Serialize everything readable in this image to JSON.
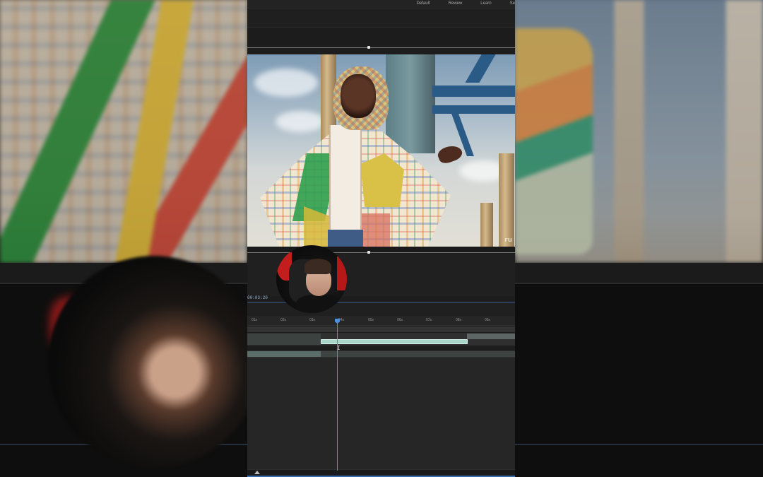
{
  "workspace_tabs": [
    "Default",
    "Review",
    "Learn",
    "Se"
  ],
  "timeline": {
    "timecode": "00:03:20",
    "ruler_ticks": [
      "01s",
      "02s",
      "03s",
      "04s",
      "05s",
      "06s",
      "07s",
      "08s",
      "09s"
    ],
    "playhead_label": "04s"
  },
  "video": {
    "watermark": "ru"
  },
  "colors": {
    "playhead": "#4a90e2",
    "selected_clip": "#a7d6c8",
    "panel_bg": "#1d1d1d"
  }
}
